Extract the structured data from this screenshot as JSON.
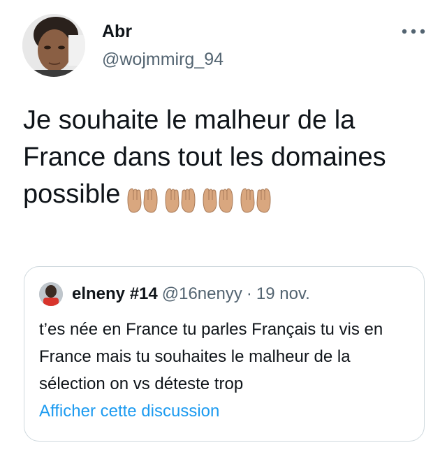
{
  "author": {
    "display_name": "Abr",
    "handle": "@wojmmirg_94"
  },
  "tweet": {
    "text": "Je souhaite le malheur de la France dans tout les domaines possible",
    "emoji_icon": "palms-up-together-icon",
    "emoji_count": 4,
    "emoji_skin_tone": "#d9a77f"
  },
  "menu": {
    "icon": "more-horizontal-icon"
  },
  "quote": {
    "display_name": "elneny #14",
    "handle": "@16nenyy",
    "separator": "·",
    "date": "19 nov.",
    "text": "t’es née en France tu parles Français tu vis en France mais tu souhaites le malheur de la sélection on vs déteste trop",
    "link_label": "Afficher cette discussion"
  },
  "colors": {
    "text": "#0f1419",
    "secondary": "#536471",
    "link": "#1d9bf0",
    "border": "#cfd9de"
  }
}
